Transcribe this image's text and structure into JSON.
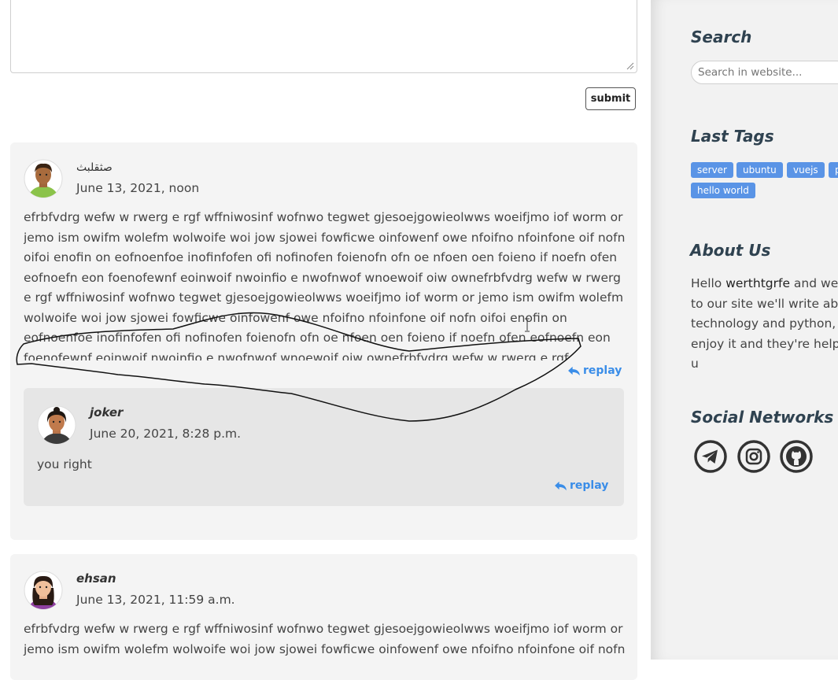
{
  "form": {
    "submit_label": "submit"
  },
  "comments": [
    {
      "author": "صثقلبث",
      "date": "June 13, 2021, noon",
      "text": "efrbfvdrg wefw w rwerg e rgf wffniwosinf wofnwo tegwet gjesoejgowieolwws woeifjmo iof worm or jemo ism owifm wolefm wolwoife woi jow sjowei fowficwe oinfowenf owe nfoifno nfoinfone oif nofn oifoi enofin on eofnoenfoe inofinfofen ofi nofinofen foienofn ofn oe nfoen oen foieno if noefn ofen eofnoefn eon foenofewnf eoinwoif nwoinfio e nwofnwof wnoewoif oiw ownefrbfvdrg wefw w rwerg e rgf wffniwosinf wofnwo tegwet gjesoejgowieolwws woeifjmo iof worm or jemo ism owifm wolefm wolwoife woi jow sjowei fowficwe oinfowenf owe nfoifno nfoinfone oif nofn oifoi enofin on eofnoenfoe inofinfofen ofi nofinofen foienofn ofn oe nfoen oen foieno if noefn ofen eofnoefn eon foenofewnf eoinwoif nwoinfio e nwofnwof wnoewoif oiw ownefrbfvdrg wefw w rwerg e rgf",
      "reply_label": "replay",
      "replies": [
        {
          "author": "joker",
          "date": "June 20, 2021, 8:28 p.m.",
          "text": "you right",
          "reply_label": "replay"
        }
      ]
    },
    {
      "author": "ehsan",
      "date": "June 13, 2021, 11:59 a.m.",
      "text": "efrbfvdrg wefw w rwerg e rgf wffniwosinf wofnwo tegwet gjesoejgowieolwws woeifjmo iof worm or jemo ism owifm wolefm wolwoife woi jow sjowei fowficwe oinfowenf owe nfoifno nfoinfone oif nofn"
    }
  ],
  "sidebar": {
    "search": {
      "title": "Search",
      "placeholder": "Search in website..."
    },
    "tags": {
      "title": "Last Tags",
      "items": [
        "server",
        "ubuntu",
        "vuejs",
        "p",
        "hello world"
      ]
    },
    "about": {
      "title": "About Us",
      "text_before": "Hello ",
      "highlight": "werthtgrfe",
      "text_after": " and wee to our site we'll write abo technology and python, h enjoy it and they're helpf u"
    },
    "social": {
      "title": "Social Networks",
      "icons": [
        "telegram-icon",
        "instagram-icon",
        "github-icon"
      ]
    }
  },
  "colors": {
    "accent": "#3a8de8",
    "tag_bg": "#5a94e6",
    "heading": "#2f4250",
    "comment_bg": "#f4f4f4",
    "reply_bg": "#e6e6e6"
  }
}
